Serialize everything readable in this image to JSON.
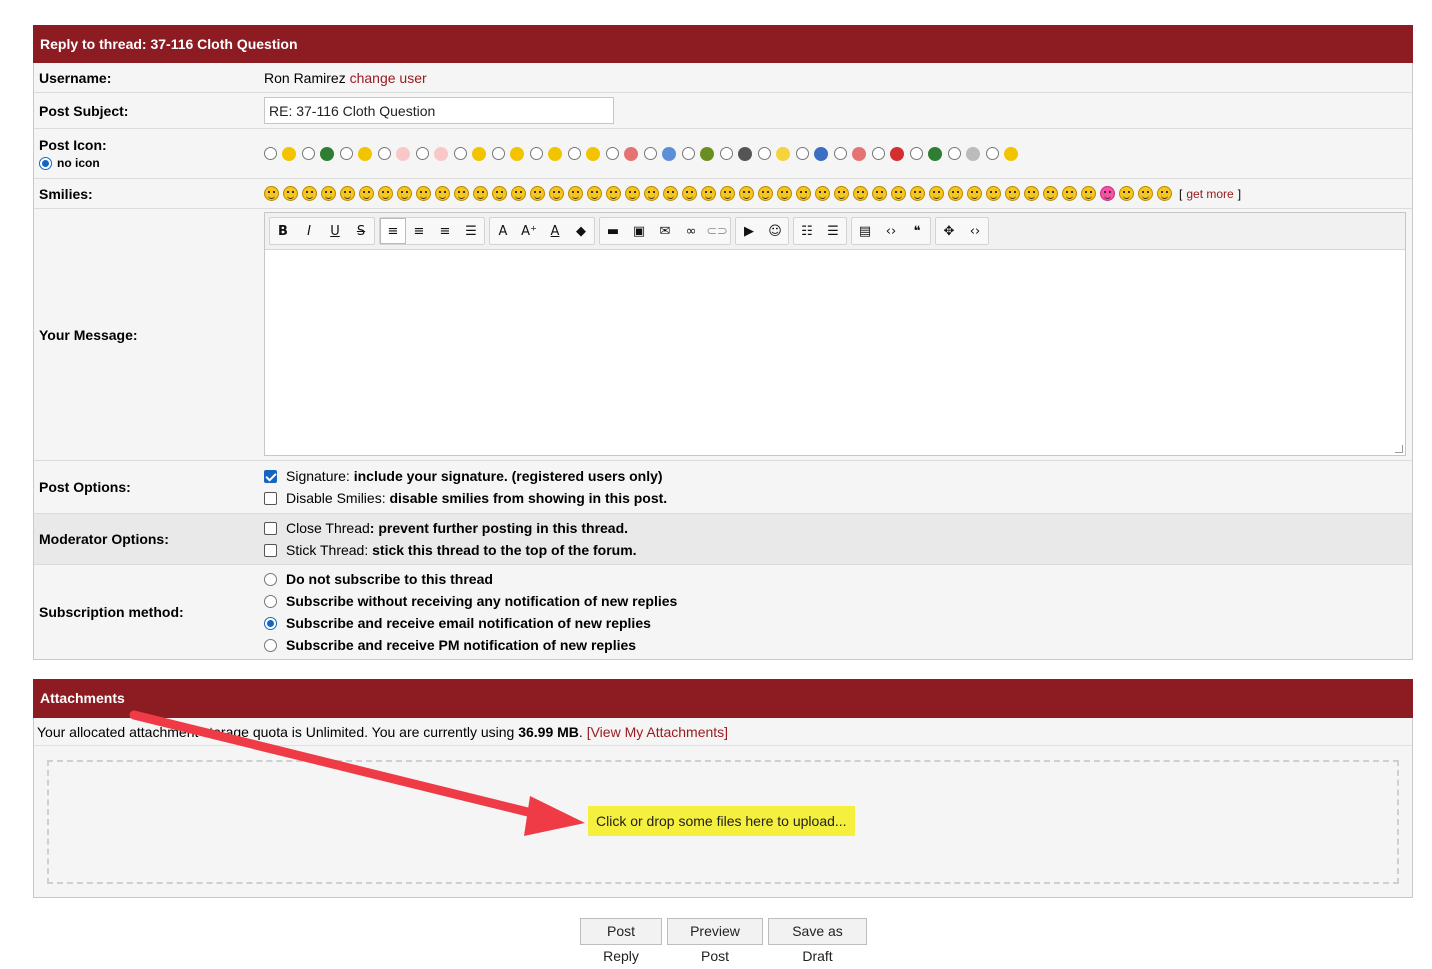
{
  "reply_panel": {
    "title": "Reply to thread: 37-116 Cloth Question",
    "username_label": "Username:",
    "username_value": "Ron Ramirez",
    "change_user_link": "change user",
    "post_subject_label": "Post Subject:",
    "post_subject_value": "RE: 37-116 Cloth Question",
    "post_icon_label": "Post Icon:",
    "no_icon_label": "no icon",
    "smilies_label": "Smilies:",
    "get_more": "get more",
    "bracket_open": "[",
    "bracket_close": "]",
    "message_label": "Your Message:",
    "post_options_label": "Post Options:",
    "signature_label": "Signature:",
    "signature_desc": "include your signature. (registered users only)",
    "disable_smilies_label": "Disable Smilies:",
    "disable_smilies_desc": "disable smilies from showing in this post.",
    "moderator_options_label": "Moderator Options:",
    "close_thread_label": "Close Thread",
    "close_thread_desc": ": prevent further posting in this thread.",
    "stick_thread_label": "Stick Thread:",
    "stick_thread_desc": "stick this thread to the top of the forum.",
    "subscription_label": "Subscription method:",
    "subscription_options": [
      "Do not subscribe to this thread",
      "Subscribe without receiving any notification of new replies",
      "Subscribe and receive email notification of new replies",
      "Subscribe and receive PM notification of new replies"
    ],
    "subscription_selected_index": 2,
    "signature_checked": true,
    "disable_smilies_checked": false,
    "close_thread_checked": false,
    "stick_thread_checked": false
  },
  "post_icons": [
    "smile-icon",
    "film-icon",
    "wink-icon",
    "thumbs-up-icon",
    "thumbs-down-icon",
    "star-icon",
    "grin-icon",
    "surprised-icon",
    "sad-icon",
    "rainbow-icon",
    "question-icon",
    "picture-icon",
    "music-icon",
    "lightbulb-icon",
    "info-icon",
    "heart-icon",
    "exclamation-icon",
    "bug-icon",
    "cube-icon",
    "laugh-icon"
  ],
  "attachments": {
    "title": "Attachments",
    "quota_text_pre": "Your allocated attachment storage quota is Unlimited. You are currently using",
    "quota_used": "36.99 MB",
    "view_link": "[View My Attachments]",
    "dropzone_text": "Click or drop some files here to upload..."
  },
  "buttons": {
    "post_reply": "Post Reply",
    "preview_post": "Preview Post",
    "save_draft": "Save as Draft"
  },
  "colors": {
    "header_bg": "#8c1c22",
    "link": "#9b1b20",
    "highlight": "#f5ef3e",
    "arrow": "#ee3b46"
  }
}
